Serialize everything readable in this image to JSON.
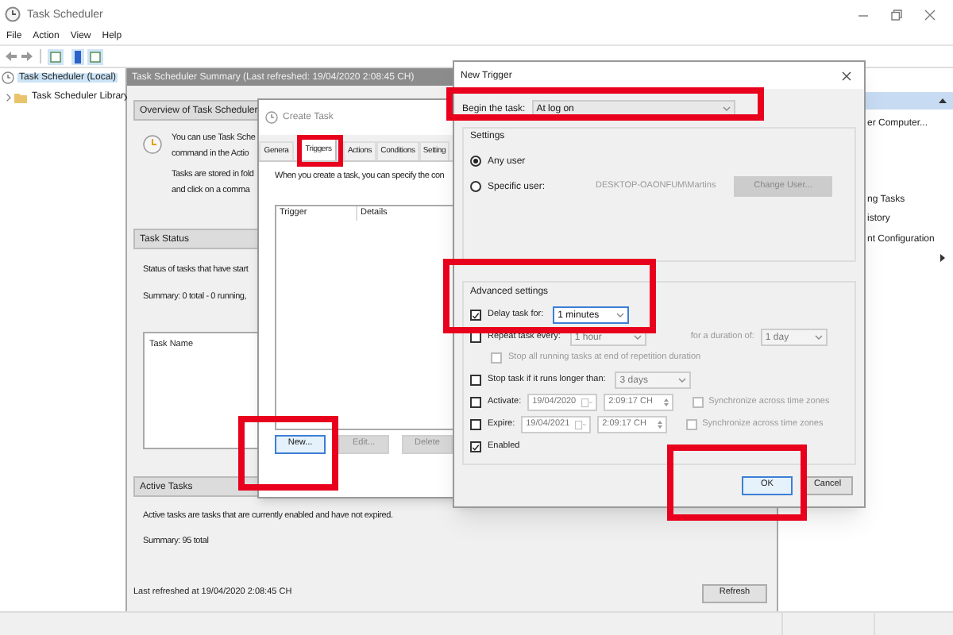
{
  "main_window": {
    "title": "Task Scheduler",
    "menu": [
      "File",
      "Action",
      "View",
      "Help"
    ],
    "tree": [
      {
        "label": "Task Scheduler (Local)",
        "selected": true,
        "children": [
          {
            "label": "Task Scheduler Library",
            "selected": false
          }
        ]
      }
    ],
    "summary_title": "Task Scheduler Summary (Last refreshed: 19/04/2020 2:08:45 CH)",
    "overview": {
      "title": "Overview of Task Scheduler",
      "paragraphs": [
        [
          "You can use Task Sche",
          "command in the Actio"
        ],
        [
          "Tasks are stored in fold",
          "and click on a comma"
        ]
      ]
    },
    "task_status": {
      "title": "Task Status",
      "lines": [
        "Status of tasks that have start",
        "Summary: 0 total - 0 running,"
      ],
      "columns": [
        "Task Name"
      ]
    },
    "active_tasks": {
      "title": "Active Tasks",
      "lines": [
        "Active tasks are tasks that are currently enabled and have not expired.",
        "Summary: 95 total"
      ]
    },
    "last_refreshed": "Last refreshed at 19/04/2020 2:08:45 CH",
    "refresh_button": "Refresh",
    "actions_pane": {
      "items": [
        "er Computer...",
        "ng Tasks",
        "istory",
        "nt Configuration"
      ]
    }
  },
  "create_task": {
    "title": "Create Task",
    "tabs": [
      {
        "label": "Genera",
        "selected": false
      },
      {
        "label": "Triggers",
        "selected": true
      },
      {
        "label": "Actions",
        "selected": false
      },
      {
        "label": "Conditions",
        "selected": false
      },
      {
        "label": "Setting",
        "selected": false
      }
    ],
    "description": "When you create a task, you can specify the con",
    "columns": [
      "Trigger",
      "Details"
    ],
    "buttons": [
      {
        "label": "New...",
        "disabled": false,
        "focused": true
      },
      {
        "label": "Edit...",
        "disabled": true,
        "focused": false
      },
      {
        "label": "Delete",
        "disabled": true,
        "focused": false
      }
    ]
  },
  "new_trigger": {
    "title": "New Trigger",
    "begin_label": "Begin the task:",
    "begin_value": "At log on",
    "settings": {
      "title": "Settings",
      "options": [
        {
          "label": "Any user",
          "selected": true
        },
        {
          "label": "Specific user:",
          "selected": false
        }
      ],
      "user": "DESKTOP-OAONFUM\\Martins",
      "change_user_button": {
        "label": "Change User...",
        "disabled": true
      }
    },
    "advanced": {
      "title": "Advanced settings",
      "rows": [
        {
          "kind": "check",
          "label": "Delay task for:",
          "checked": true,
          "disabled": false,
          "fields": [
            {
              "kind": "combo",
              "value": "1 minutes",
              "disabled": false
            }
          ]
        },
        {
          "kind": "check",
          "label": "Repeat task every:",
          "checked": false,
          "disabled": false,
          "fields": [
            {
              "kind": "combo",
              "value": "1 hour",
              "disabled": true
            },
            {
              "kind": "text",
              "value": "for a duration of:"
            },
            {
              "kind": "combo",
              "value": "1 day",
              "disabled": true
            }
          ]
        },
        {
          "kind": "subcheck",
          "label": "Stop all running tasks at end of repetition duration",
          "checked": false,
          "disabled": true,
          "fields": []
        },
        {
          "kind": "check",
          "label": "Stop task if it runs longer than:",
          "checked": false,
          "disabled": false,
          "fields": [
            {
              "kind": "combo",
              "value": "3 days",
              "disabled": true
            }
          ]
        },
        {
          "kind": "check",
          "label": "Activate:",
          "checked": false,
          "disabled": false,
          "fields": [
            {
              "kind": "date",
              "value": "19/04/2020",
              "disabled": true
            },
            {
              "kind": "time",
              "value": "2:09:17 CH",
              "disabled": true
            },
            {
              "kind": "sync",
              "label": "Synchronize across time zones",
              "checked": false,
              "disabled": true
            }
          ]
        },
        {
          "kind": "check",
          "label": "Expire:",
          "checked": false,
          "disabled": false,
          "fields": [
            {
              "kind": "date",
              "value": "19/04/2021",
              "disabled": true
            },
            {
              "kind": "time",
              "value": "2:09:17 CH",
              "disabled": true
            },
            {
              "kind": "sync",
              "label": "Synchronize across time zones",
              "checked": false,
              "disabled": true
            }
          ]
        },
        {
          "kind": "check",
          "label": "Enabled",
          "checked": true,
          "disabled": false,
          "fields": []
        }
      ]
    },
    "buttons": [
      {
        "label": "OK",
        "default": true
      },
      {
        "label": "Cancel",
        "default": false
      }
    ]
  }
}
